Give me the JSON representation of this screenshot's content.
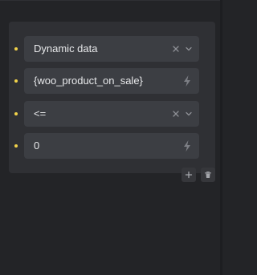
{
  "conditions": {
    "rows": [
      {
        "value": "Dynamic data",
        "control": "select",
        "clear_icon": "close-icon",
        "dropdown_icon": "chevron-down-icon"
      },
      {
        "value": "{woo_product_on_sale}",
        "control": "text",
        "action_icon": "lightning-bolt-icon"
      },
      {
        "value": "<=",
        "control": "select",
        "clear_icon": "close-icon",
        "dropdown_icon": "chevron-down-icon"
      },
      {
        "value": "0",
        "control": "text",
        "action_icon": "lightning-bolt-icon"
      }
    ],
    "actions": [
      {
        "name": "add",
        "icon": "plus-icon"
      },
      {
        "name": "delete",
        "icon": "trash-icon"
      }
    ]
  },
  "colors": {
    "background": "#232427",
    "panel": "#2f3034",
    "field": "#3c3e43",
    "text": "#e8e9eb",
    "icon": "#8e9096",
    "indicator_dot": "#f2d34a"
  }
}
